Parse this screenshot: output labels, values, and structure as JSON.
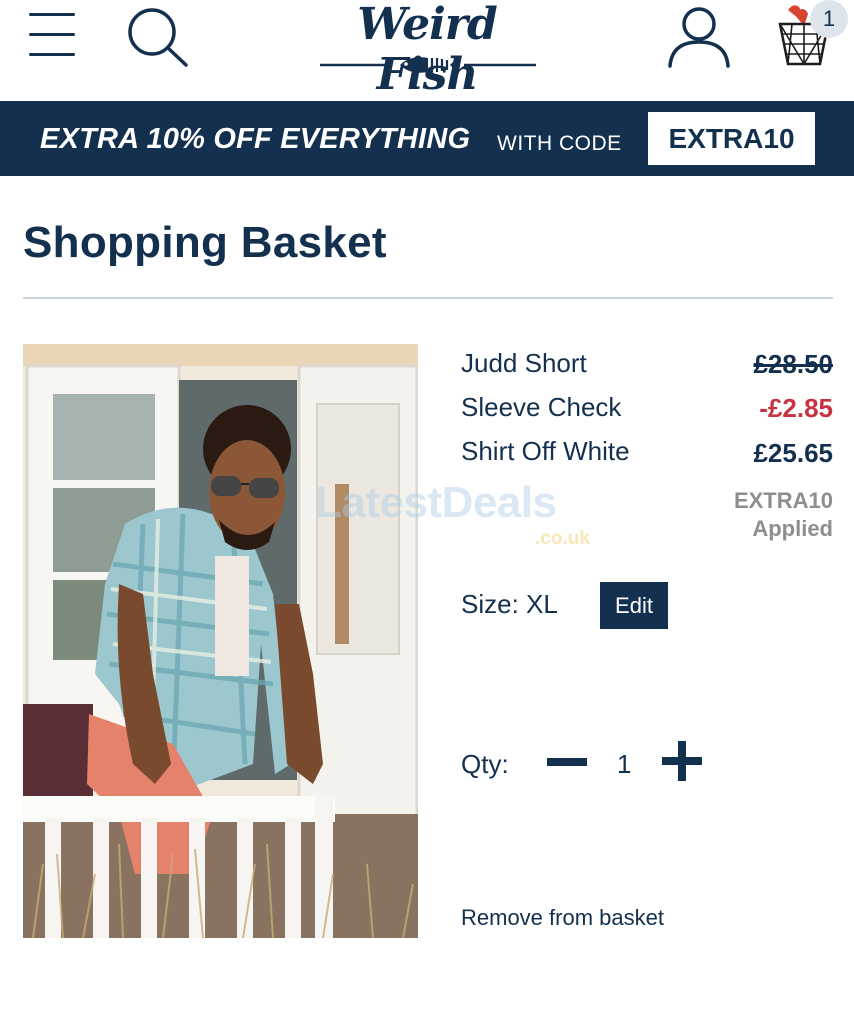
{
  "header": {
    "logo_text": "Weird Fish",
    "basket_count": "1",
    "icons": [
      "menu-icon",
      "search-icon",
      "account-icon",
      "basket-icon"
    ]
  },
  "promo": {
    "headline": "EXTRA 10% OFF EVERYTHING",
    "with_code": "WITH CODE",
    "code": "EXTRA10"
  },
  "page": {
    "title": "Shopping Basket"
  },
  "item": {
    "name_lines": [
      "Judd Short",
      "Sleeve Check",
      "Shirt Off White"
    ],
    "price_original": "£28.50",
    "price_discount": "-£2.85",
    "price_final": "£25.65",
    "code_line1": "EXTRA10",
    "code_line2": "Applied",
    "size_label": "Size: XL",
    "edit_label": "Edit",
    "qty_label": "Qty:",
    "qty_value": "1",
    "remove_label": "Remove from basket"
  },
  "watermark": {
    "main": "LatestDeals",
    "sub": ".co.uk"
  },
  "colors": {
    "navy": "#14304f",
    "discount_red": "#c8333f",
    "muted_grey": "#8e8e8e",
    "divider": "#c9d3dd"
  }
}
